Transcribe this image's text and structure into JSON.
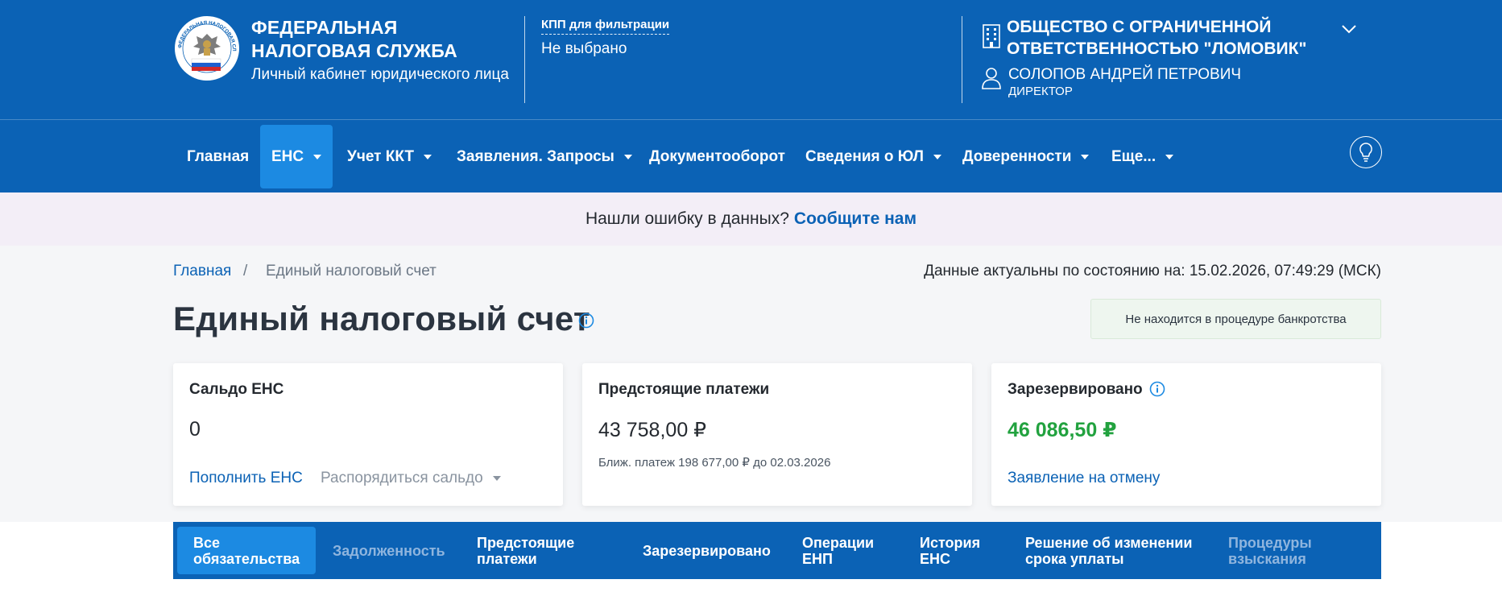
{
  "header": {
    "brand_line1": "ФЕДЕРАЛЬНАЯ",
    "brand_line2": "НАЛОГОВАЯ СЛУЖБА",
    "brand_subtitle": "Личный кабинет юридического лица",
    "kpp_label": "КПП для фильтрации",
    "kpp_value": "Не выбрано",
    "org_line1": "ОБЩЕСТВО С ОГРАНИЧЕННОЙ",
    "org_line2": "ОТВЕТСТВЕННОСТЬЮ \"ЛОМОВИК\"",
    "user_name": "СОЛОПОВ АНДРЕЙ ПЕТРОВИЧ",
    "user_role": "ДИРЕКТОР",
    "logo_text": "ФЕДЕРАЛЬНАЯ НАЛОГОВАЯ СЛУЖБА"
  },
  "nav": {
    "items": [
      {
        "label": "Главная",
        "dropdown": false,
        "active": false
      },
      {
        "label": "ЕНС",
        "dropdown": true,
        "active": true
      },
      {
        "label": "Учет ККТ",
        "dropdown": true,
        "active": false
      },
      {
        "label": "Заявления. Запросы",
        "dropdown": true,
        "active": false
      },
      {
        "label": "Документооборот",
        "dropdown": false,
        "active": false
      },
      {
        "label": "Сведения о ЮЛ",
        "dropdown": true,
        "active": false
      },
      {
        "label": "Доверенности",
        "dropdown": true,
        "active": false
      },
      {
        "label": "Еще...",
        "dropdown": true,
        "active": false
      }
    ],
    "help_icon": "lightbulb-icon"
  },
  "banner": {
    "text": "Нашли ошибку в данных?",
    "link": "Сообщите нам"
  },
  "breadcrumb": {
    "home": "Главная",
    "separator": "/",
    "current": "Единый налоговый счет"
  },
  "updated": "Данные актуальны по состоянию на: 15.02.2026, 07:49:29 (МСК)",
  "page": {
    "title": "Единый налоговый счет",
    "bankruptcy_status": "Не находится в процедуре банкротства"
  },
  "cards": {
    "balance": {
      "title": "Сальдо ЕНС",
      "value": "0",
      "link_primary": "Пополнить ЕНС",
      "link_secondary": "Распорядиться сальдо"
    },
    "upcoming": {
      "title": "Предстоящие платежи",
      "value": "43 758,00 ₽",
      "note": "Ближ. платеж 198 677,00 ₽ до 02.03.2026"
    },
    "reserved": {
      "title": "Зарезервировано",
      "value": "46 086,50 ₽",
      "link": "Заявление на отмену"
    }
  },
  "tabs": [
    {
      "line1": "Все",
      "line2": "обязательства",
      "active": true,
      "disabled": false
    },
    {
      "line1": "Задолженность",
      "line2": "",
      "active": false,
      "disabled": true
    },
    {
      "line1": "Предстоящие",
      "line2": "платежи",
      "active": false,
      "disabled": false
    },
    {
      "line1": "Зарезервировано",
      "line2": "",
      "active": false,
      "disabled": false
    },
    {
      "line1": "Операции",
      "line2": "ЕНП",
      "active": false,
      "disabled": false
    },
    {
      "line1": "История",
      "line2": "ЕНС",
      "active": false,
      "disabled": false
    },
    {
      "line1": "Решение об изменении",
      "line2": "срока уплаты",
      "active": false,
      "disabled": false
    },
    {
      "line1": "Процедуры",
      "line2": "взыскания",
      "active": false,
      "disabled": true
    }
  ],
  "colors": {
    "primary": "#0b62b5",
    "active_tab": "#1c8ae2",
    "positive": "#22a23f",
    "banner_bg": "#f3eef7"
  }
}
